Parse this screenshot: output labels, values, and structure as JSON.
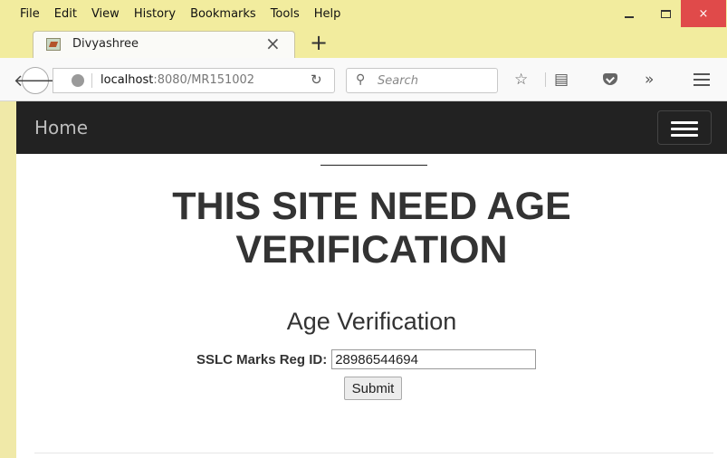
{
  "menubar": {
    "items": [
      "File",
      "Edit",
      "View",
      "History",
      "Bookmarks",
      "Tools",
      "Help"
    ],
    "window_controls": {
      "minimize": "minimize-icon",
      "maximize": "maximize-icon",
      "close": "×"
    }
  },
  "tab": {
    "title": "Divyashree",
    "close": "×",
    "new_tab": "+"
  },
  "navbar": {
    "url_host": "localhost",
    "url_rest": ":8080/MR151002",
    "search_placeholder": "Search",
    "icons": [
      "back-arrow-icon",
      "globe-icon",
      "reload-icon",
      "search-icon",
      "star-icon",
      "reading-list-icon",
      "pocket-icon",
      "overflow-icon",
      "hamburger-menu-icon"
    ]
  },
  "site": {
    "nav_home": "Home",
    "title_line1": "THIS SITE NEED AGE",
    "title_line2": "VERIFICATION",
    "subtitle": "Age Verification",
    "form": {
      "label": "SSLC Marks Reg ID:",
      "value": "28986544694",
      "submit_label": "Submit"
    }
  },
  "colors": {
    "chrome_bg": "#f2ec9e",
    "site_header": "#222222",
    "close_button": "#e04a4a"
  }
}
